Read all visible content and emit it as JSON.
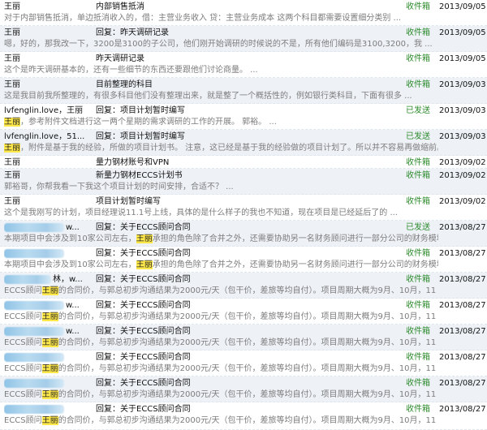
{
  "rows": [
    {
      "sender": "王丽",
      "subject": "内部销售抵消",
      "folder": "收件箱",
      "date": "2013/09/05",
      "preview": "对于内部销售抵消，单边抵消收入的，借：主营业务收入 贷：主营业务成本  这两个科目都需要设置细分类别 ..."
    },
    {
      "sender": "王丽",
      "subject": "回复：昨天调研记录",
      "folder": "收件箱",
      "date": "2013/09/05",
      "preview": "嗯，好的，那我改一下，3200是3100的子公司，他们刚开始调研的时候说的不是，所有他们编码是3100,3200，我 ..."
    },
    {
      "sender": "王丽",
      "subject": "昨天调研记录",
      "folder": "收件箱",
      "date": "2013/09/05",
      "preview": "这个是昨天调研基本的，还有一些细节的东西还要跟他们讨论商量。 ..."
    },
    {
      "sender": "王丽",
      "subject": "目前整理的科目",
      "folder": "收件箱",
      "date": "2013/09/03",
      "preview": "这是我目前我所整理的，有很多科目他们没有整理出来，就是整了一个概括性的，例如银行类科目，下面有很多 ..."
    },
    {
      "sender": "lvfenglin.love，王丽",
      "subject": "回复：项目计划暂时编写",
      "folder": "已发送",
      "date": "2013/09/03",
      "preview_pre": "",
      "preview_mark": "王丽",
      "preview_post": "，参考附件文档进行这一两个星期的需求调研的工作的开展。  郭裕。 ..."
    },
    {
      "sender": "lvfenglin.love，51...",
      "subject": "回复：项目计划暂时编写",
      "folder": "已发送",
      "date": "2013/09/03",
      "preview_pre": "",
      "preview_mark": "王丽",
      "preview_post": "，附件是基于我的经验，所做的项目计划书。 注意，这已经是基于我的经验做的项目计划了。所以并不容易再做缩前。 11 ..."
    },
    {
      "sender": "王丽",
      "subject": "量力钢材账号和VPN",
      "folder": "收件箱",
      "date": "2013/09/02",
      "preview": ""
    },
    {
      "sender": "王丽",
      "subject": "新量力钢材ECCS计划书",
      "folder": "收件箱",
      "date": "2013/09/02",
      "preview": "郭裕哥，你帮我看一下我这个项目计划的时间安排，合适不？ ..."
    },
    {
      "sender": "王丽",
      "subject": "项目计划暂时编写",
      "folder": "收件箱",
      "date": "2013/09/02",
      "preview": "这个是我刚写的计划，项目经理说11.1号上线，具体的是什么样子的我也不知道，现在项目是已经延后了的 ..."
    },
    {
      "sender_suffix": "w...",
      "subject": "回复：关于ECCS顾问合同",
      "folder": "已发送",
      "date": "2013/08/27",
      "preview_pre": "本期项目中会涉及到10家公司左右，",
      "preview_mark": "王丽",
      "preview_post": "承担的角色除了合并之外，还需要协助另一名财务顾问进行一部分公司的财务模块实施。 ..."
    },
    {
      "sender_suffix": "",
      "subject": "回复：关于ECCS顾问合同",
      "folder": "收件箱",
      "date": "2013/08/27",
      "preview_pre": "本期项目中会涉及到10家公司左右，",
      "preview_mark": "王丽",
      "preview_post": "承担的角色除了合并之外，还需要协助另一名财务顾问进行一部分公司的财务模块实施。 ..."
    },
    {
      "sender_suffix": "林，w...",
      "subject": "回复：关于ECCS顾问合同",
      "folder": "收件箱",
      "date": "2013/08/27",
      "preview_pre": "ECCS顾问",
      "preview_mark": "王丽",
      "preview_post": "的合同价，与郭总初步沟通结果为2000元/天（包干价，差旅等均自付）。项目周期大概为9月、10月，11 ..."
    },
    {
      "sender_suffix": "w...",
      "subject": "回复：关于ECCS顾问合同",
      "folder": "收件箱",
      "date": "2013/08/27",
      "preview_pre": "ECCS顾问",
      "preview_mark": "王丽",
      "preview_post": "的合同价，与郭总初步沟通结果为2000元/天（包干价，差旅等均自付）。项目周期大概为9月、10月，11 ..."
    },
    {
      "sender_suffix": "w...",
      "subject": "回复：关于ECCS顾问合同",
      "folder": "收件箱",
      "date": "2013/08/27",
      "preview_pre": "ECCS顾问",
      "preview_mark": "王丽",
      "preview_post": "的合同价，与郭总初步沟通结果为2000元/天（包干价，差旅等均自付）。项目周期大概为9月、10月，11 ..."
    },
    {
      "sender_suffix": "",
      "subject": "回复：关于ECCS顾问合同",
      "folder": "收件箱",
      "date": "2013/08/27",
      "preview_pre": "ECCS顾问",
      "preview_mark": "王丽",
      "preview_post": "的合同价，与郭总初步沟通结果为2000元/天（包干价，差旅等均自付）。项目周期大概为9月、10月，11 ..."
    },
    {
      "sender_suffix": "",
      "subject": "回复：关于ECCS顾问合同",
      "folder": "收件箱",
      "date": "2013/08/27",
      "preview_pre": "ECCS顾问",
      "preview_mark": "王丽",
      "preview_post": "的合同价，与郭总初步沟通结果为2000元/天（包干价，差旅等均自付）。项目周期大概为9月、10月，11 ..."
    },
    {
      "sender_suffix": "",
      "subject": "回复：关于ECCS顾问合同",
      "folder": "收件箱",
      "date": "2013/08/27",
      "preview_pre": "ECCS顾问",
      "preview_mark": "王丽",
      "preview_post": "的合同价，与郭总初步沟通结果为2000元/天（包干价，差旅等均自付）。项目周期大概为9月、10月，11 ..."
    }
  ]
}
